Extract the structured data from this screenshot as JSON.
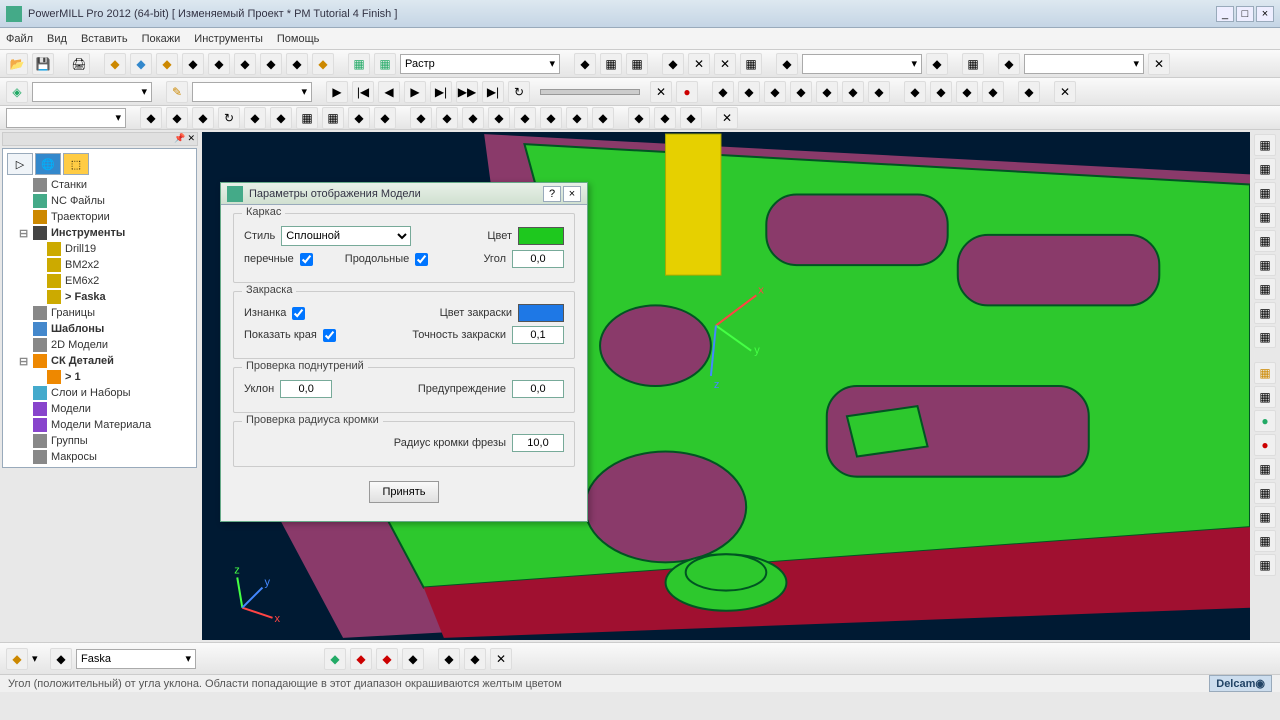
{
  "window": {
    "title": "PowerMILL Pro 2012 (64-bit)     [ Изменяемый Проект * PM Tutorial 4 Finish ]"
  },
  "menu": [
    "Файл",
    "Вид",
    "Вставить",
    "Покажи",
    "Инструменты",
    "Помощь"
  ],
  "toolbar1": {
    "dropdown": "Растр"
  },
  "tree": {
    "items": [
      {
        "label": "Станки",
        "icon": "#888"
      },
      {
        "label": "NC Файлы",
        "icon": "#4a8"
      },
      {
        "label": "Траектории",
        "icon": "#c80"
      },
      {
        "label": "Инструменты",
        "icon": "#444",
        "bold": true,
        "children": [
          {
            "label": "Drill19",
            "icon": "#ca0"
          },
          {
            "label": "BM2x2",
            "icon": "#ca0"
          },
          {
            "label": "EM6x2",
            "icon": "#ca0"
          },
          {
            "label": "> Faska",
            "icon": "#ca0",
            "bold": true
          }
        ]
      },
      {
        "label": "Границы",
        "icon": "#888"
      },
      {
        "label": "Шаблоны",
        "icon": "#48c",
        "bold": true
      },
      {
        "label": "2D Модели",
        "icon": "#888"
      },
      {
        "label": "СК Деталей",
        "icon": "#e80",
        "bold": true,
        "children": [
          {
            "label": "> 1",
            "icon": "#e80",
            "bold": true
          }
        ]
      },
      {
        "label": "Слои и Наборы",
        "icon": "#4ac"
      },
      {
        "label": "Модели",
        "icon": "#84c"
      },
      {
        "label": "Модели Материала",
        "icon": "#84c"
      },
      {
        "label": "Группы",
        "icon": "#888"
      },
      {
        "label": "Макросы",
        "icon": "#888"
      }
    ]
  },
  "dialog": {
    "title": "Параметры отображения Модели",
    "karkas": {
      "legend": "Каркас",
      "style_label": "Стиль",
      "style_value": "Сплошной",
      "color_label": "Цвет",
      "color_value": "#1ec81e",
      "cross_label": "перечные",
      "long_label": "Продольные",
      "angle_label": "Угол",
      "angle_value": "0,0"
    },
    "zakraska": {
      "legend": "Закраска",
      "inside_label": "Изнанка",
      "fillcolor_label": "Цвет закраски",
      "fillcolor_value": "#1e78e6",
      "edges_label": "Показать края",
      "accuracy_label": "Точность закраски",
      "accuracy_value": "0,1"
    },
    "undercut": {
      "legend": "Проверка поднутрений",
      "slope_label": "Уклон",
      "slope_value": "0,0",
      "warn_label": "Предупреждение",
      "warn_value": "0,0"
    },
    "radius": {
      "legend": "Проверка радиуса кромки",
      "label": "Радиус кромки фрезы",
      "value": "10,0"
    },
    "accept": "Принять"
  },
  "bottom": {
    "tool": "Faska"
  },
  "status": {
    "text": "Угол (положительный) от угла уклона. Области попадающие в этот диапазон окрашиваются желтым цветом",
    "brand": "Delcam"
  }
}
